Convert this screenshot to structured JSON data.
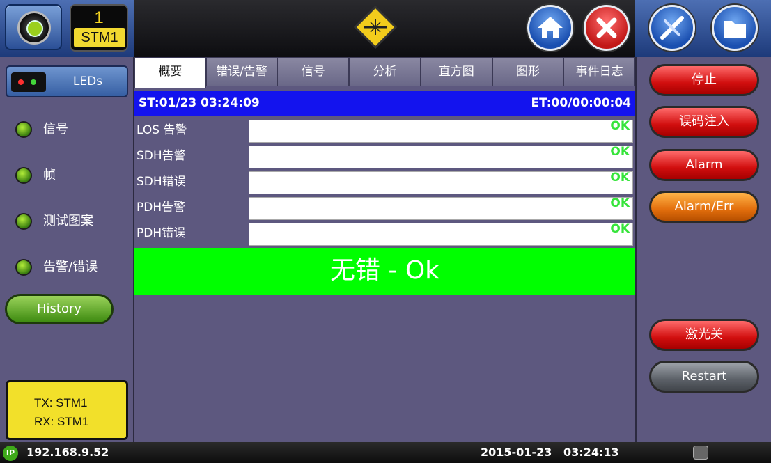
{
  "header": {
    "port_number": "1",
    "port_label": "STM1"
  },
  "sidebar": {
    "leds_label": "LEDs",
    "items": [
      {
        "label": "信号"
      },
      {
        "label": "帧"
      },
      {
        "label": "测试图案"
      },
      {
        "label": "告警/错误"
      }
    ],
    "history_label": "History",
    "tx": "TX: STM1",
    "rx": "RX: STM1"
  },
  "main": {
    "tabs": [
      {
        "label": "概要",
        "active": true
      },
      {
        "label": "错误/告警"
      },
      {
        "label": "信号"
      },
      {
        "label": "分析"
      },
      {
        "label": "直方图"
      },
      {
        "label": "图形"
      },
      {
        "label": "事件日志"
      }
    ],
    "start_time": "ST:01/23 03:24:09",
    "elapsed_time": "ET:00/00:00:04",
    "status_rows": [
      {
        "label": "LOS 告警",
        "value": "OK"
      },
      {
        "label": "SDH告警",
        "value": "OK"
      },
      {
        "label": "SDH错误",
        "value": "OK"
      },
      {
        "label": "PDH告警",
        "value": "OK"
      },
      {
        "label": "PDH错误",
        "value": "OK"
      }
    ],
    "summary": "无错 - Ok"
  },
  "actions": {
    "stop": "停止",
    "error_inject": "误码注入",
    "alarm": "Alarm",
    "alarm_err": "Alarm/Err",
    "laser_off": "激光关",
    "restart": "Restart"
  },
  "statusbar": {
    "ip_icon": "IP",
    "ip": "192.168.9.52",
    "datetime": "2015-01-23   03:24:13"
  },
  "colors": {
    "accent_blue": "#1313ee",
    "ok_green": "#00ff00",
    "panel": "#5d587f",
    "button_red": "#d10e0e",
    "button_orange": "#e26e0c"
  },
  "icons": {
    "logo": "veex-logo-icon",
    "laser": "laser-warning-icon",
    "home": "home-icon",
    "close": "close-icon",
    "tools": "tools-icon",
    "folder": "folder-icon",
    "network": "network-icon"
  }
}
